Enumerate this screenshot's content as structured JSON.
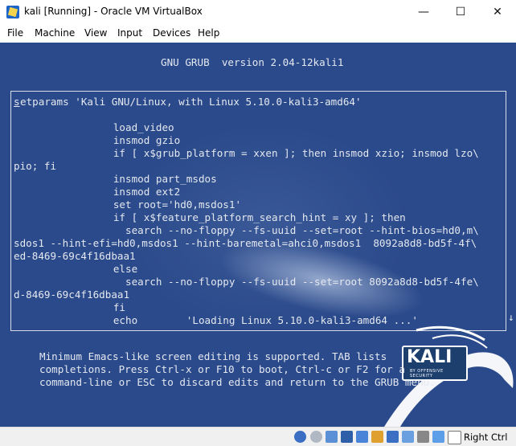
{
  "window": {
    "title": "kali [Running] - Oracle VM VirtualBox",
    "minimize_glyph": "—",
    "maximize_glyph": "☐",
    "close_glyph": "✕"
  },
  "menubar": {
    "items": [
      "File",
      "Machine",
      "View",
      "Input",
      "Devices",
      "Help"
    ]
  },
  "grub": {
    "header": "GNU GRUB  version 2.04-12kali1",
    "cursor_char": "s",
    "lines": [
      "etparams 'Kali GNU/Linux, with Linux 5.10.0-kali3-amd64'",
      "",
      "          load_video",
      "          insmod gzio",
      "          if [ x$grub_platform = xxen ]; then insmod xzio; insmod lzo\\",
      "pio; fi",
      "          insmod part_msdos",
      "          insmod ext2",
      "          set root='hd0,msdos1'",
      "          if [ x$feature_platform_search_hint = xy ]; then",
      "            search --no-floppy --fs-uuid --set=root --hint-bios=hd0,m\\",
      "sdos1 --hint-efi=hd0,msdos1 --hint-baremetal=ahci0,msdos1  8092a8d8-bd5f-4f\\",
      "ed-8469-69c4f16dbaa1",
      "          else",
      "            search --no-floppy --fs-uuid --set=root 8092a8d8-bd5f-4fe\\",
      "d-8469-69c4f16dbaa1",
      "          fi",
      "          echo        'Loading Linux 5.10.0-kali3-amd64 ...'"
    ],
    "scroll_arrow": "↓",
    "help": [
      "Minimum Emacs-like screen editing is supported. TAB lists",
      "completions. Press Ctrl-x or F10 to boot, Ctrl-c or F2 for a",
      "command-line or ESC to discard edits and return to the GRUB menu."
    ]
  },
  "logo": {
    "name": "KALI",
    "tagline": "BY OFFENSIVE SECURITY"
  },
  "statusbar": {
    "icons": [
      "optical-drive-icon",
      "audio-icon",
      "network-icon",
      "usb-icon",
      "shared-folders-icon",
      "display-icon",
      "video-capture-icon",
      "cpu-icon",
      "mouse-integration-icon",
      "download-icon",
      "host-key-arrow-icon"
    ],
    "host_key": "Right Ctrl"
  }
}
